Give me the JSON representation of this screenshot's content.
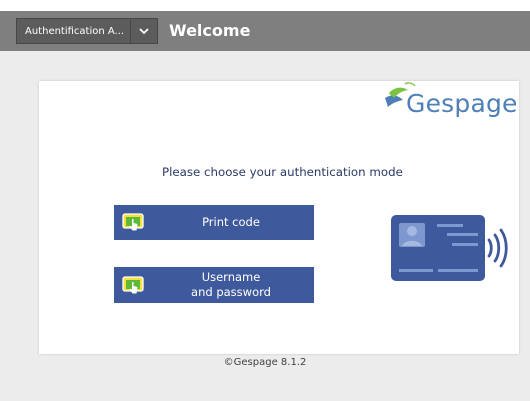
{
  "header": {
    "auth_mode_select_value": "Authentification A...",
    "title": "Welcome"
  },
  "brand": {
    "logo_text": "Gespage"
  },
  "main": {
    "prompt": "Please choose your authentication mode",
    "buttons": [
      {
        "label": "Print code"
      },
      {
        "label_line1": "Username",
        "label_line2": "and password"
      }
    ]
  },
  "footer": {
    "text": "©Gespage 8.1.2"
  },
  "colors": {
    "header_bg": "#7f7f7f",
    "select_bg": "#5c5c5c",
    "page_bg": "#ececec",
    "button_bg": "#3f5a9c",
    "logo_blue": "#4e7fb7",
    "logo_green": "#7cc243",
    "icon_yellow": "#f6e23a",
    "icon_green": "#5fb83a"
  },
  "icons": [
    "chevron-down-icon",
    "touch-screen-icon",
    "id-card-icon",
    "wireless-signal-icon"
  ]
}
